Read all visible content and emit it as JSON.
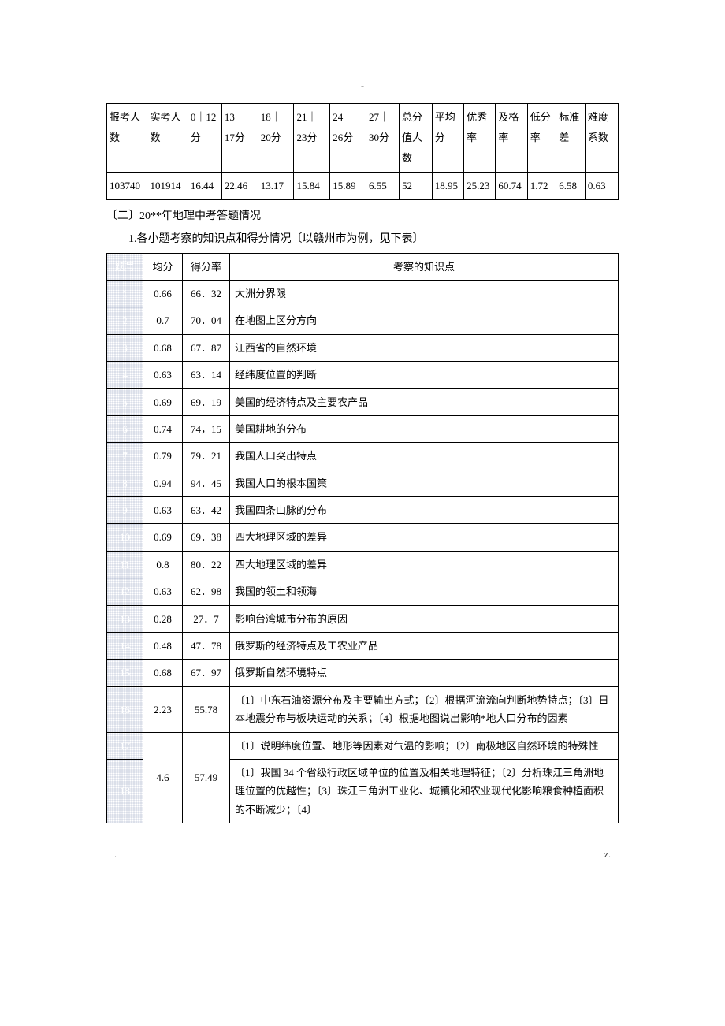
{
  "top_marker": "-",
  "stats_table": {
    "headers": [
      "报考人数",
      "实考人数",
      "0｜12分",
      "13｜17分",
      "18｜20分",
      "21｜23分",
      "24｜26分",
      "27｜30分",
      "总分值人数",
      "平均分",
      "优秀率",
      "及格率",
      "低分率",
      "标准差",
      "难度系数"
    ],
    "values": [
      "103740",
      "101914",
      "16.44",
      "22.46",
      "13.17",
      "15.84",
      "15.89",
      "6.55",
      "52",
      "18.95",
      "25.23",
      "60.74",
      "1.72",
      "6.58",
      "0.63"
    ]
  },
  "section_2_title": "〔二〕20**年地理中考答题情况",
  "section_2_sub": "1.各小题考察的知识点和得分情况〔以赣州市为例，见下表〕",
  "scores_headers": {
    "qnum": "题号",
    "avg": "均分",
    "rate": "得分率",
    "topic": "考察的知识点"
  },
  "rows": [
    {
      "q": "1",
      "avg": "0.66",
      "rate": "66．32",
      "topic": "大洲分界限"
    },
    {
      "q": "2",
      "avg": "0.7",
      "rate": "70．04",
      "topic": "在地图上区分方向"
    },
    {
      "q": "3",
      "avg": "0.68",
      "rate": "67．87",
      "topic": "江西省的自然环境"
    },
    {
      "q": "4",
      "avg": "0.63",
      "rate": "63．14",
      "topic": "经纬度位置的判断"
    },
    {
      "q": "5",
      "avg": "0.69",
      "rate": "69．19",
      "topic": "美国的经济特点及主要农产品"
    },
    {
      "q": "6",
      "avg": "0.74",
      "rate": "74，15",
      "topic": "美国耕地的分布"
    },
    {
      "q": "7",
      "avg": "0.79",
      "rate": "79．21",
      "topic": "我国人口突出特点"
    },
    {
      "q": "8",
      "avg": "0.94",
      "rate": "94．45",
      "topic": "我国人口的根本国策"
    },
    {
      "q": "9",
      "avg": "0.63",
      "rate": "63．42",
      "topic": "我国四条山脉的分布"
    },
    {
      "q": "10",
      "avg": "0.69",
      "rate": "69．38",
      "topic": "四大地理区域的差异"
    },
    {
      "q": "11",
      "avg": "0.8",
      "rate": "80．22",
      "topic": "四大地理区域的差异"
    },
    {
      "q": "12",
      "avg": "0.63",
      "rate": "62．98",
      "topic": "我国的领土和领海"
    },
    {
      "q": "13",
      "avg": "0.28",
      "rate": "27．7",
      "topic": "影响台湾城市分布的原因"
    },
    {
      "q": "14",
      "avg": "0.48",
      "rate": "47．78",
      "topic": "俄罗斯的经济特点及工农业产品"
    },
    {
      "q": "15",
      "avg": "0.68",
      "rate": "67．97",
      "topic": "俄罗斯自然环境特点"
    }
  ],
  "row16": {
    "q": "16",
    "avg": "2.23",
    "rate": "55.78",
    "topic": "〔1〕中东石油资源分布及主要输出方式；〔2〕根据河流流向判断地势特点；〔3〕日本地震分布与板块运动的关系；〔4〕根据地图说出影响*地人口分布的因素"
  },
  "row17": {
    "q": "17",
    "topic": "〔1〕说明纬度位置、地形等因素对气温的影响；〔2〕南极地区自然环境的特殊性"
  },
  "row18": {
    "q": "18",
    "avg": "4.6",
    "rate": "57.49",
    "topic": "〔1〕我国 34 个省级行政区域单位的位置及相关地理特征；〔2〕分析珠江三角洲地理位置的优越性；〔3〕珠江三角洲工业化、城镇化和农业现代化影响粮食种植面积的不断减少；〔4〕"
  },
  "footer": {
    "left": ".",
    "right": "z."
  }
}
